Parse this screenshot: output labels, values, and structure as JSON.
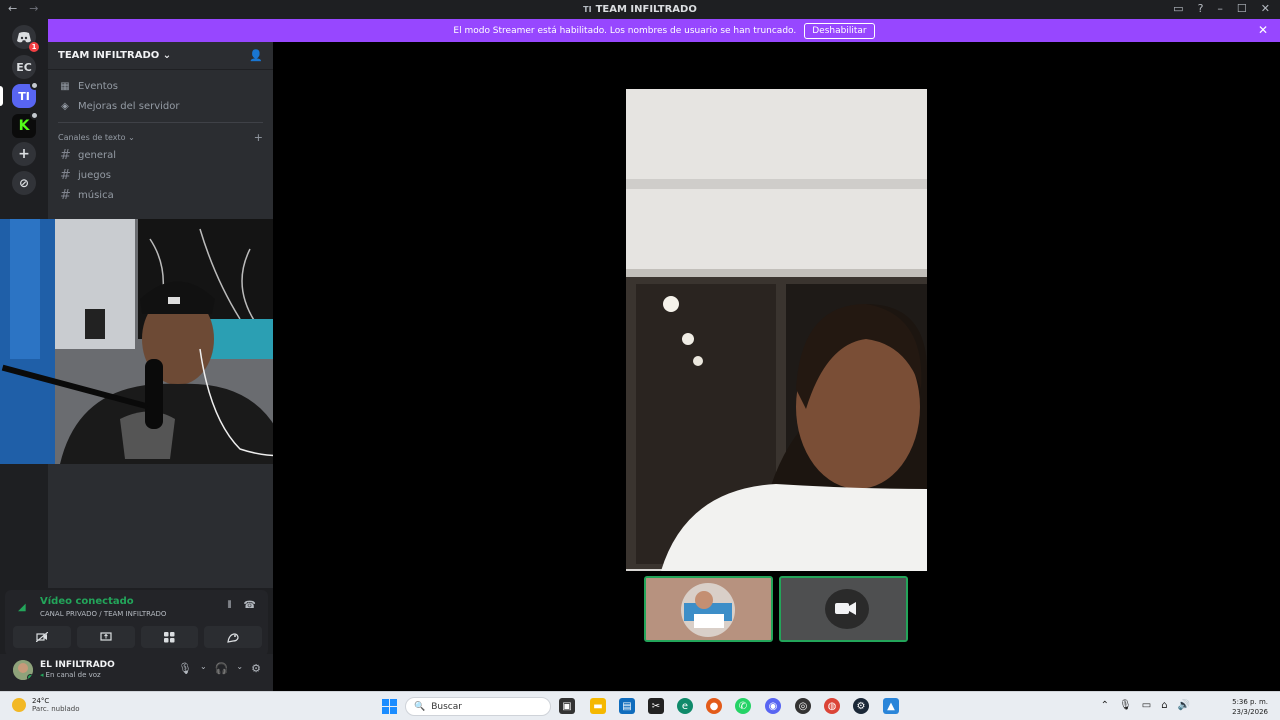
{
  "window": {
    "title": "TEAM INFILTRADO",
    "back": "←",
    "forward": "→",
    "title_icon": "TI"
  },
  "banner": {
    "message": "El modo Streamer está habilitado. Los nombres de usuario se han truncado.",
    "button": "Deshabilitar"
  },
  "guilds": [
    {
      "label": "",
      "icon": "discord-icon",
      "badge": "1"
    },
    {
      "label": "EC"
    },
    {
      "label": "TI",
      "active": true
    },
    {
      "label": "K",
      "icon": "kick-icon"
    },
    {
      "label": "+",
      "icon": "add-server-icon"
    },
    {
      "label": "⊘",
      "icon": "discover-icon"
    }
  ],
  "server": {
    "name": "TEAM INFILTRADO",
    "items": [
      {
        "label": "Eventos",
        "icon": "calendar-icon"
      },
      {
        "label": "Mejoras del servidor",
        "icon": "boost-icon"
      }
    ],
    "category": "Canales de texto",
    "channels": [
      "general",
      "juegos",
      "música"
    ]
  },
  "voice": {
    "status": "Vídeo conectado",
    "channel": "CANAL PRIVADO / TEAM INFILTRADO"
  },
  "user": {
    "name": "EL INFILTRADO",
    "status": "En canal de voz"
  },
  "taskbar": {
    "temp": "24°C",
    "weather": "Parc. nublado",
    "search_placeholder": "Buscar",
    "time": "5:36 p. m.",
    "date": "23/3/2026"
  },
  "colors": {
    "accent": "#9747ff",
    "connected": "#23a55a",
    "blurple": "#5865f2"
  }
}
